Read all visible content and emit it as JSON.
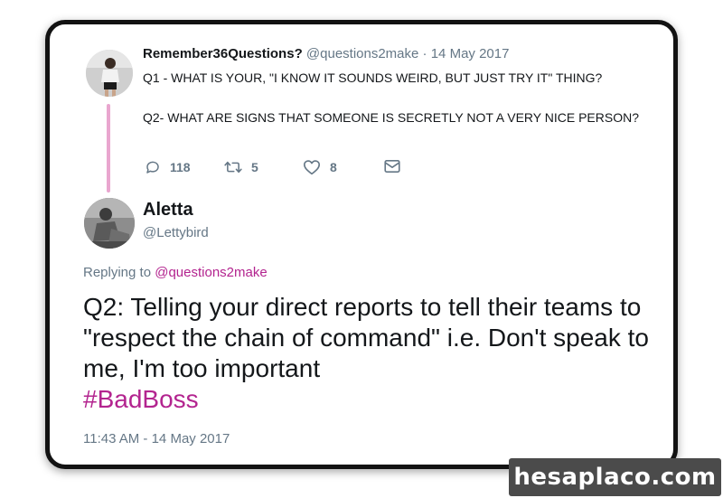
{
  "colors": {
    "frame_border": "#121212",
    "thread_line": "#e9a6cf",
    "link_pink": "#b3248f",
    "muted_text": "#657786",
    "primary_text": "#14171a",
    "watermark_bg": "#4b4b4b"
  },
  "original_tweet": {
    "display_name": "Remember36Questions?",
    "handle": "@questions2make",
    "separator": "·",
    "date": "14 May 2017",
    "lines": [
      "Q1 - WHAT IS YOUR, \"I KNOW IT SOUNDS WEIRD, BUT JUST TRY IT\" THING?",
      "Q2- WHAT ARE SIGNS THAT SOMEONE IS SECRETLY NOT A VERY NICE PERSON?"
    ],
    "actions": {
      "reply_icon": "reply-icon",
      "replies": "118",
      "retweet_icon": "retweet-icon",
      "retweets": "5",
      "like_icon": "heart-icon",
      "likes": "8",
      "dm_icon": "envelope-icon"
    }
  },
  "reply_tweet": {
    "display_name": "Aletta",
    "handle": "@Lettybird",
    "replying_prefix": "Replying to",
    "replying_to": "@questions2make",
    "body_text": "Q2: Telling your direct reports to tell their teams to \"respect the chain of command\" i.e. Don't speak to me, I'm too important",
    "hashtag": "#BadBoss",
    "timestamp": "11:43 AM - 14 May 2017"
  },
  "watermark": "hesaplaco.com"
}
